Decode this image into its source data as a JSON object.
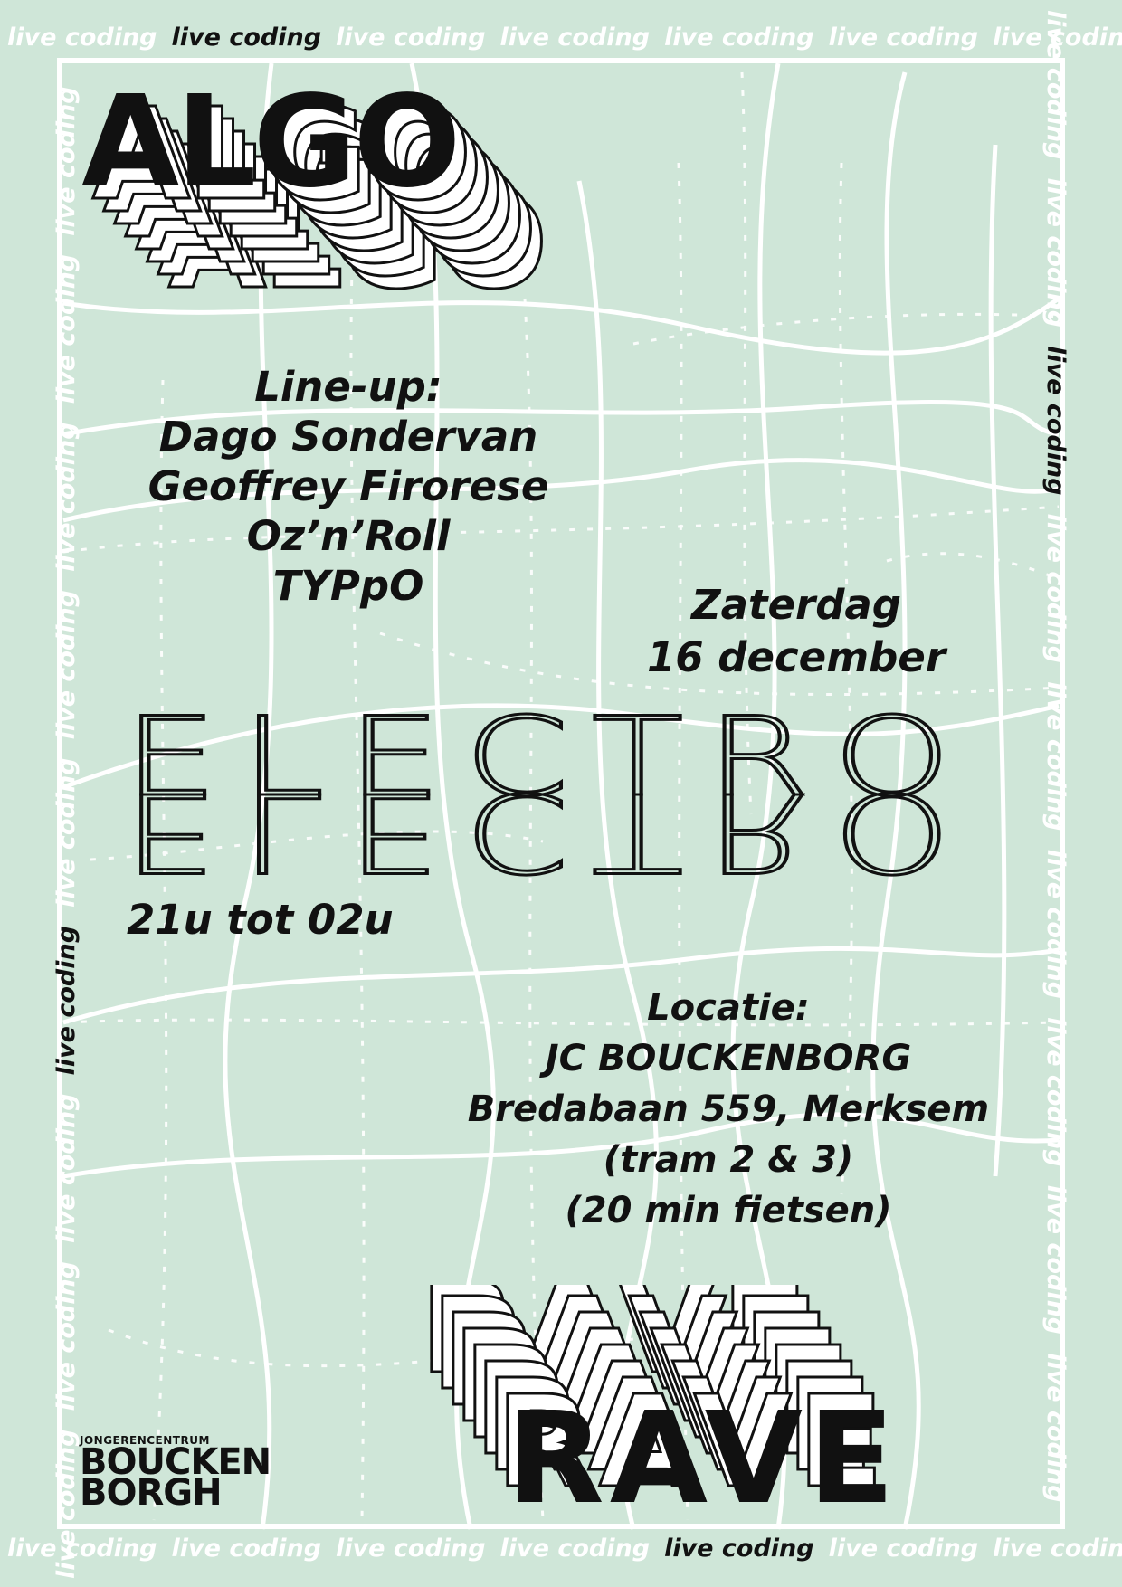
{
  "border_text": {
    "white": "live coding",
    "black": "live coding"
  },
  "title_top": "ALGO",
  "title_bottom": "RAVE",
  "lineup": {
    "heading": "Line-up:",
    "artists": [
      "Dago Sondervan",
      "Geoffrey Firorese",
      "Oz’n’Roll",
      "TYPpO"
    ]
  },
  "date": {
    "day": "Zaterdag",
    "date": "16 december"
  },
  "venue_name": "ELECTRO",
  "time": "21u tot 02u",
  "location": {
    "heading": "Locatie:",
    "name": "JC BOUCKENBORG",
    "address": "Bredabaan 559, Merksem",
    "tram": "(tram 2 & 3)",
    "bike": "(20 min fietsen)"
  },
  "logo": {
    "small": "JONGERENCENTRUM",
    "line1": "BOUCKEN",
    "line2": "BORGH"
  },
  "colors": {
    "background": "#cfe6d8",
    "ink": "#111111",
    "lines": "#ffffff"
  }
}
